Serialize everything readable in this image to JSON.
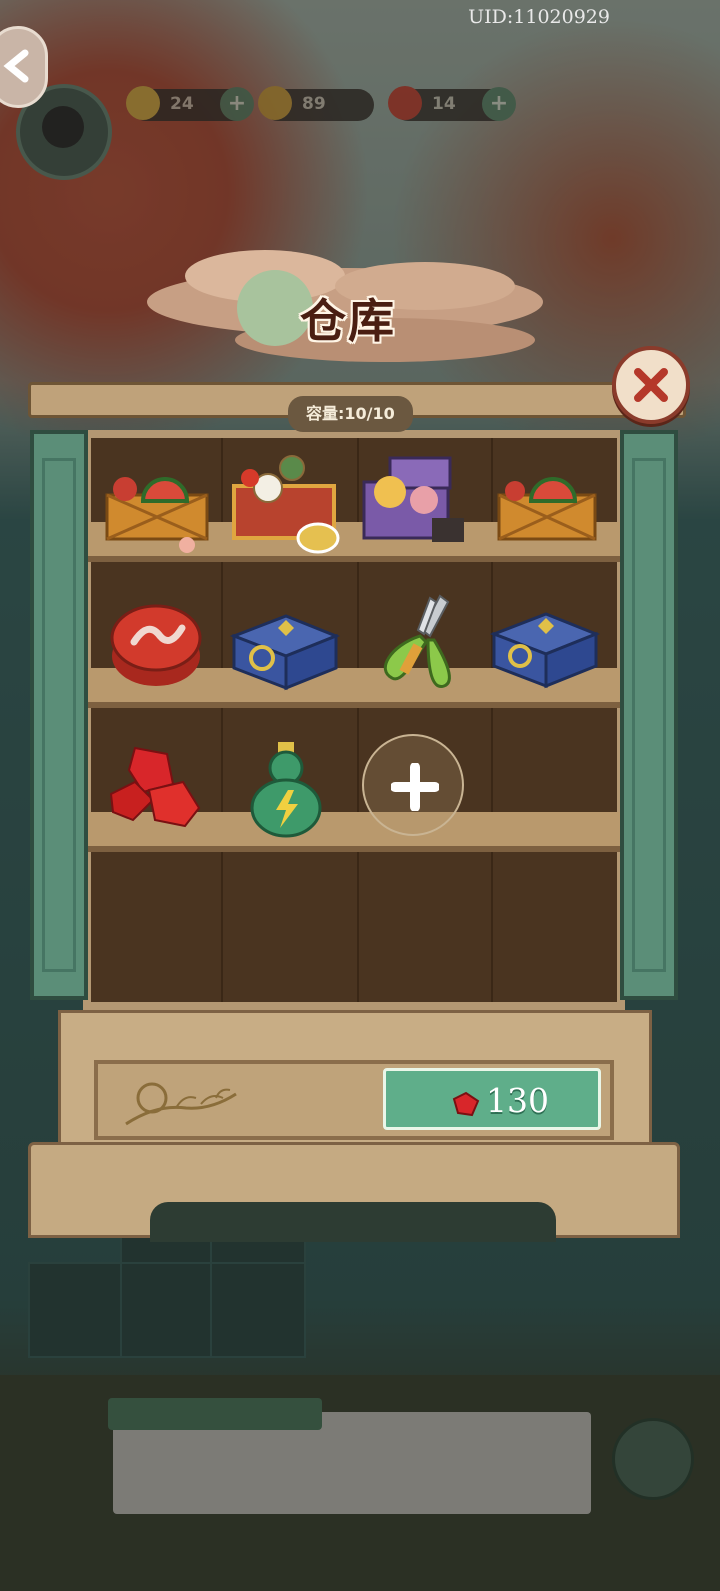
{
  "header": {
    "uid": "UID:11020929"
  },
  "resources": [
    {
      "name": "energy",
      "value": "24",
      "icon": "lightning-icon",
      "color": "#e3c04a"
    },
    {
      "name": "coins",
      "value": "89",
      "icon": "coin-icon",
      "color": "#d8a63a"
    },
    {
      "name": "gems",
      "value": "14",
      "icon": "red-gem-icon",
      "color": "#d23a2a"
    }
  ],
  "warehouse": {
    "title": "仓库",
    "capacity_label": "容量:10/10",
    "expand_price": "130",
    "items": [
      {
        "name": "fruit-basket-item",
        "icon": "fruit-basket-icon"
      },
      {
        "name": "tea-tray-item",
        "icon": "tea-tray-icon"
      },
      {
        "name": "gift-box-item",
        "icon": "purple-gift-box-icon"
      },
      {
        "name": "fruit-basket-item-2",
        "icon": "fruit-basket-icon"
      },
      {
        "name": "red-tin-item",
        "icon": "red-tin-icon"
      },
      {
        "name": "blue-chest-open-item",
        "icon": "blue-chest-icon"
      },
      {
        "name": "scissors-item",
        "icon": "pruning-shears-icon"
      },
      {
        "name": "blue-chest-item",
        "icon": "blue-chest-icon"
      },
      {
        "name": "red-gems-item",
        "icon": "red-gems-icon"
      },
      {
        "name": "energy-gourd-item",
        "icon": "energy-gourd-icon"
      }
    ]
  },
  "colors": {
    "accent_green": "#5fae8a",
    "wood": "#bfa27a",
    "door_green": "#5b8e78"
  }
}
